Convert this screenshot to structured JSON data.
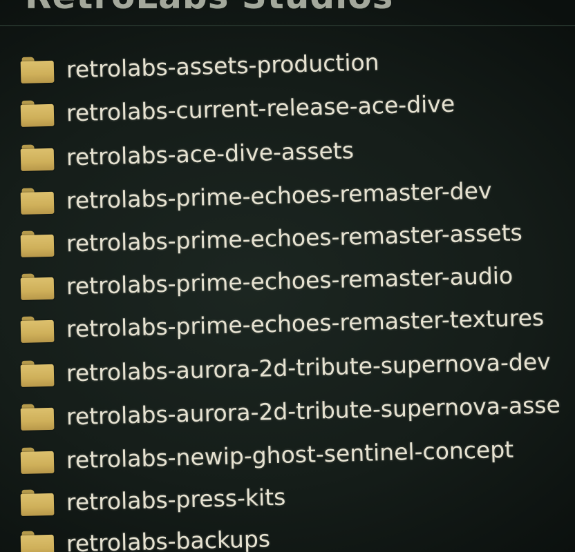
{
  "header": {
    "title": "RetroLabs Studios"
  },
  "folders": [
    {
      "name": "retrolabs-assets-production",
      "icon": "folder-icon"
    },
    {
      "name": "retrolabs-current-release-ace-dive",
      "icon": "folder-icon"
    },
    {
      "name": "retrolabs-ace-dive-assets",
      "icon": "folder-icon"
    },
    {
      "name": "retrolabs-prime-echoes-remaster-dev",
      "icon": "folder-icon"
    },
    {
      "name": "retrolabs-prime-echoes-remaster-assets",
      "icon": "folder-icon"
    },
    {
      "name": "retrolabs-prime-echoes-remaster-audio",
      "icon": "folder-icon"
    },
    {
      "name": "retrolabs-prime-echoes-remaster-textures",
      "icon": "folder-icon"
    },
    {
      "name": "retrolabs-aurora-2d-tribute-supernova-dev",
      "icon": "folder-icon"
    },
    {
      "name": "retrolabs-aurora-2d-tribute-supernova-asse",
      "icon": "folder-icon"
    },
    {
      "name": "retrolabs-newip-ghost-sentinel-concept",
      "icon": "folder-icon"
    },
    {
      "name": "retrolabs-press-kits",
      "icon": "folder-icon"
    },
    {
      "name": "retrolabs-backups",
      "icon": "folder-icon"
    }
  ],
  "colors": {
    "folder": "#d4b45f",
    "text": "#e6e2d1",
    "background": "#151d19"
  }
}
